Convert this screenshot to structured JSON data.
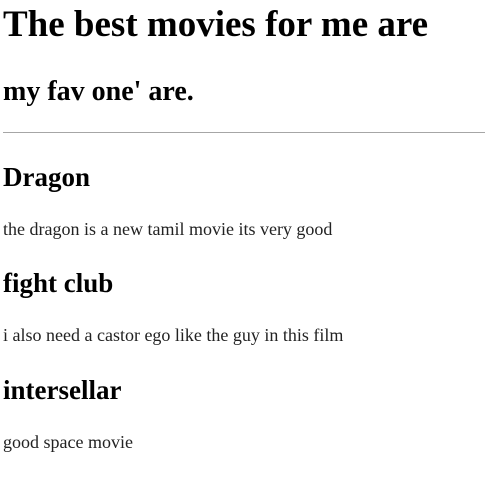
{
  "header": {
    "title": "The best movies for me are",
    "subtitle": "my fav one' are."
  },
  "movies": [
    {
      "title": "Dragon",
      "description": "the dragon is a new tamil movie its very good"
    },
    {
      "title": "fight club",
      "description": "i also need a castor ego like the guy in this film"
    },
    {
      "title": "intersellar",
      "description": "good space movie"
    }
  ]
}
